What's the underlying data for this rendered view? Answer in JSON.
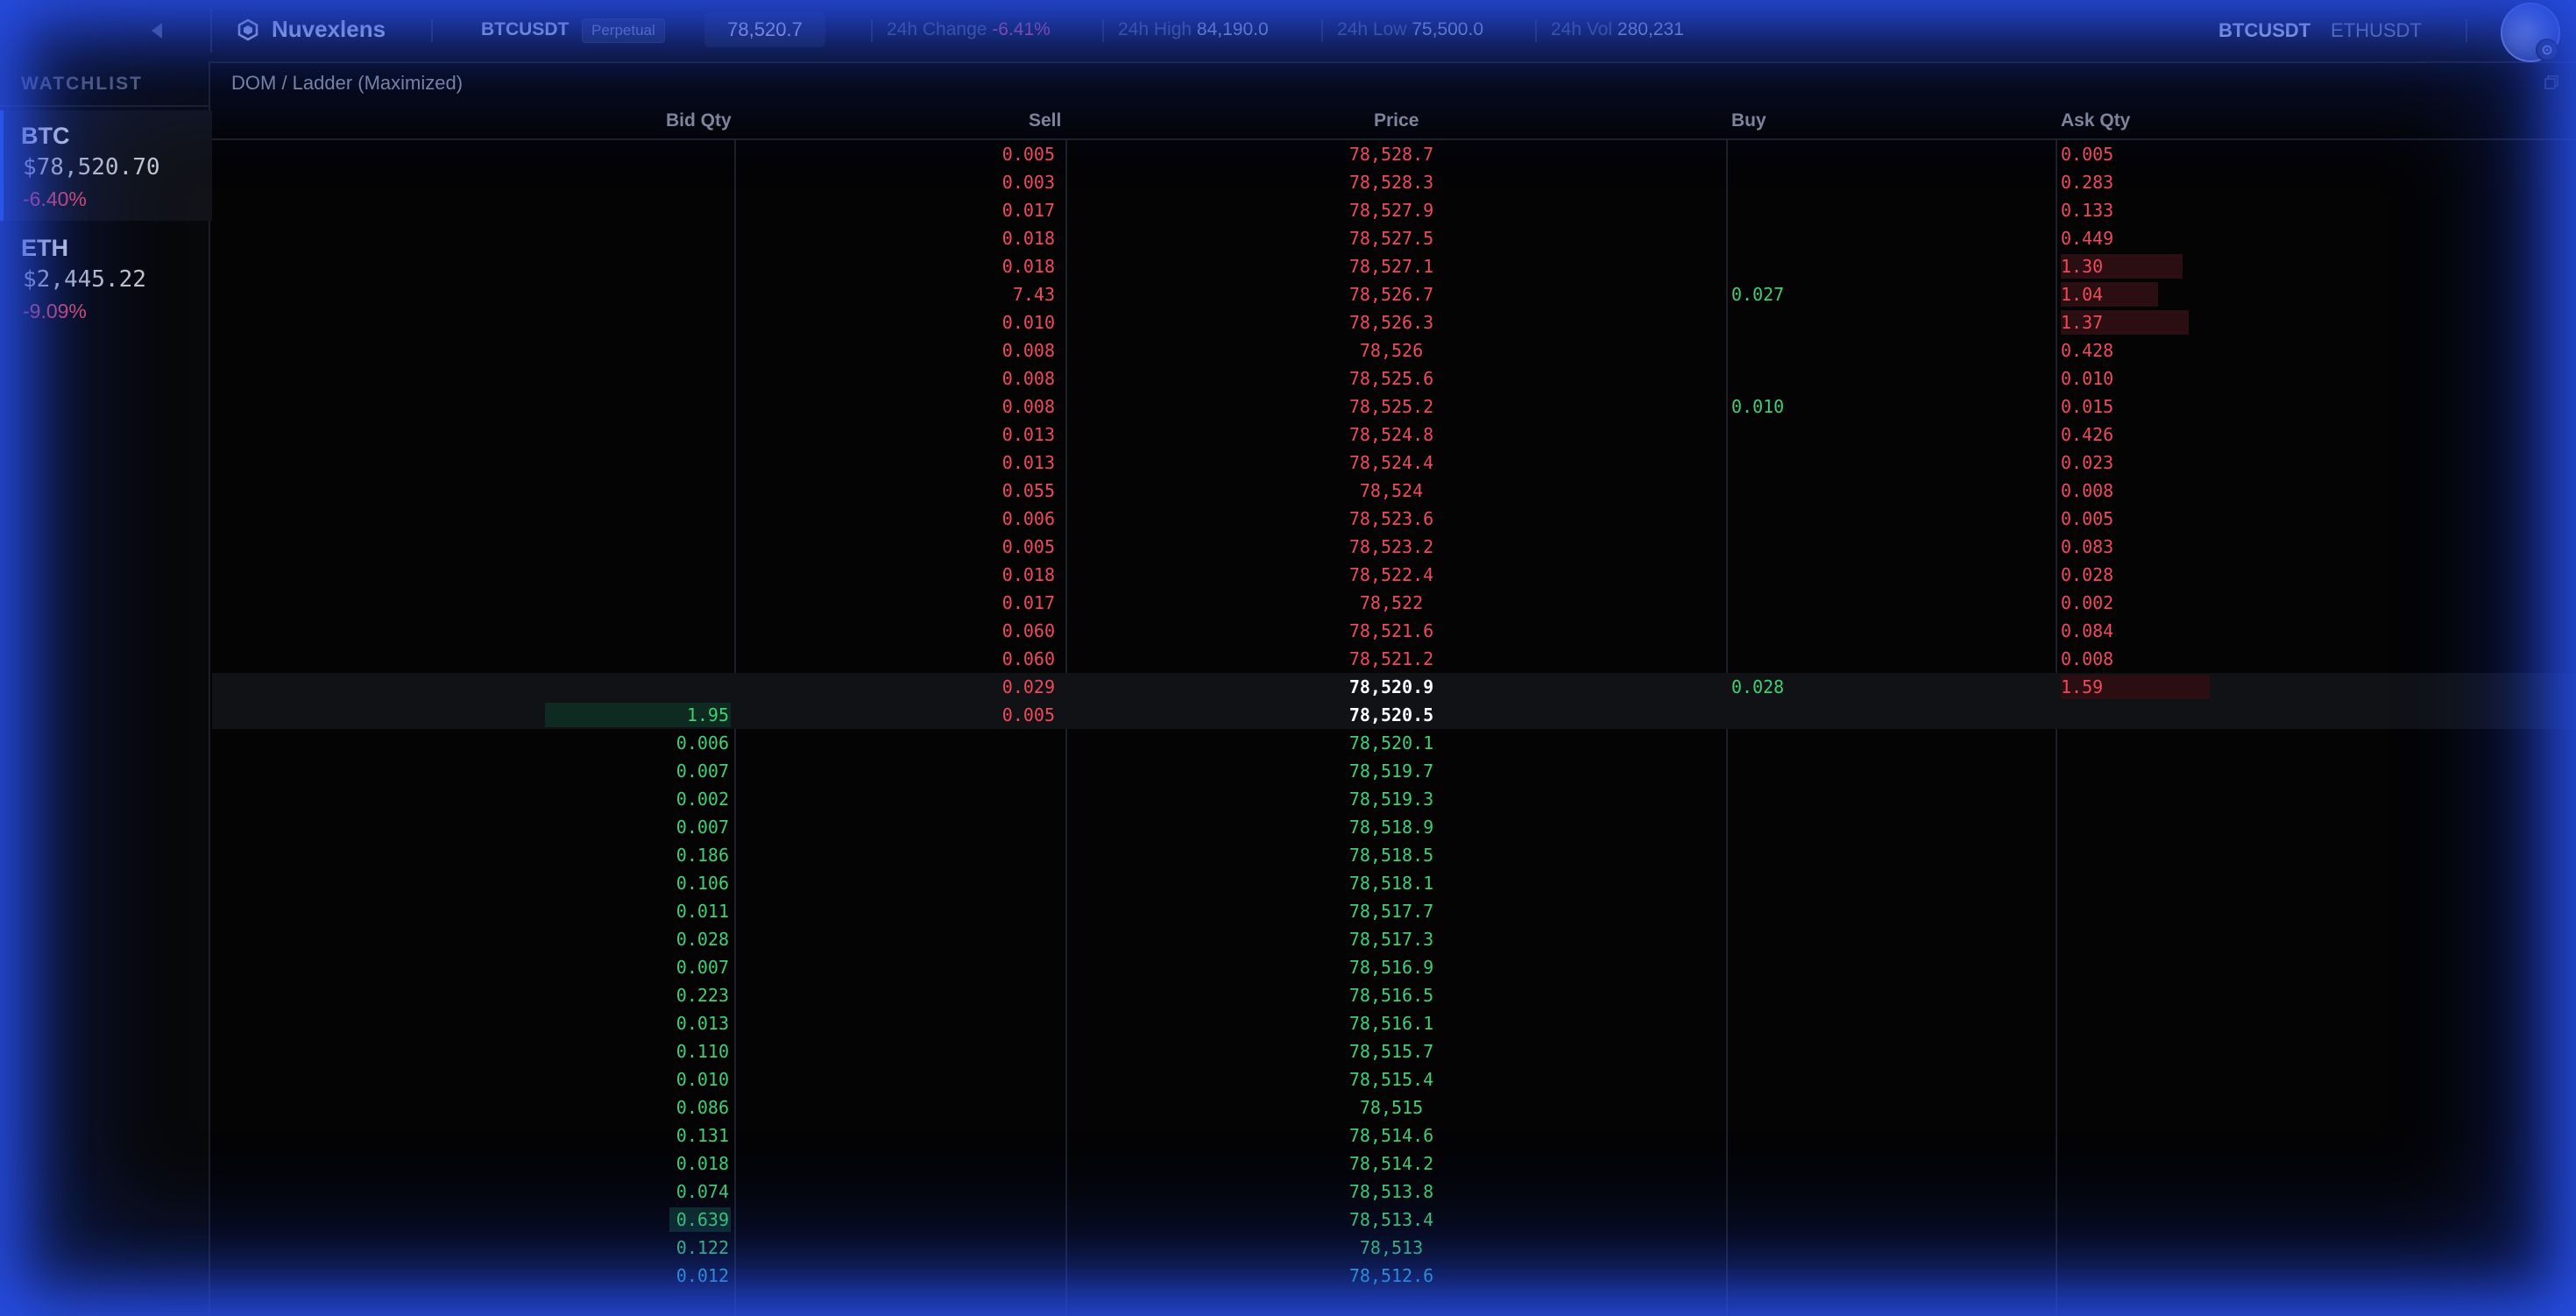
{
  "topbar": {
    "brand": "Nuvexlens",
    "symbol": "BTCUSDT",
    "badge": "Perpetual",
    "last_price": "78,520.7",
    "change_label": "24h Change",
    "change_value": "-6.41%",
    "high_label": "24h High",
    "high_value": "84,190.0",
    "low_label": "24h Low",
    "low_value": "75,500.0",
    "vol_label": "24h Vol",
    "vol_value": "280,231",
    "tabs": [
      "BTCUSDT",
      "ETHUSDT"
    ]
  },
  "sidebar": {
    "title": "WATCHLIST",
    "items": [
      {
        "symbol": "BTC",
        "price": "$78,520.70",
        "change": "-6.40%"
      },
      {
        "symbol": "ETH",
        "price": "$2,445.22",
        "change": "-9.09%"
      }
    ]
  },
  "panel": {
    "title": "DOM / Ladder (Maximized)",
    "headers": {
      "bid": "Bid Qty",
      "sell": "Sell",
      "price": "Price",
      "buy": "Buy",
      "ask": "Ask Qty"
    }
  },
  "colors": {
    "accent": "#3a7bff",
    "ask": "#f04a5a",
    "bid": "#3fd070",
    "glow": "#2850eb"
  },
  "ladder": [
    {
      "sell": "0.005",
      "price": "78,528.7",
      "buy": "",
      "ask": "0.005",
      "side": "ask"
    },
    {
      "sell": "0.003",
      "price": "78,528.3",
      "buy": "",
      "ask": "0.283",
      "side": "ask"
    },
    {
      "sell": "0.017",
      "price": "78,527.9",
      "buy": "",
      "ask": "0.133",
      "side": "ask"
    },
    {
      "sell": "0.018",
      "price": "78,527.5",
      "buy": "",
      "ask": "0.449",
      "side": "ask"
    },
    {
      "sell": "0.018",
      "price": "78,527.1",
      "buy": "",
      "ask": "1.30",
      "side": "ask",
      "ask_bar": 0.82
    },
    {
      "sell": "7.43",
      "price": "78,526.7",
      "buy": "0.027",
      "ask": "1.04",
      "side": "ask",
      "ask_bar": 0.65
    },
    {
      "sell": "0.010",
      "price": "78,526.3",
      "buy": "",
      "ask": "1.37",
      "side": "ask",
      "ask_bar": 0.86
    },
    {
      "sell": "0.008",
      "price": "78,526",
      "buy": "",
      "ask": "0.428",
      "side": "ask"
    },
    {
      "sell": "0.008",
      "price": "78,525.6",
      "buy": "",
      "ask": "0.010",
      "side": "ask"
    },
    {
      "sell": "0.008",
      "price": "78,525.2",
      "buy": "0.010",
      "ask": "0.015",
      "side": "ask"
    },
    {
      "sell": "0.013",
      "price": "78,524.8",
      "buy": "",
      "ask": "0.426",
      "side": "ask"
    },
    {
      "sell": "0.013",
      "price": "78,524.4",
      "buy": "",
      "ask": "0.023",
      "side": "ask"
    },
    {
      "sell": "0.055",
      "price": "78,524",
      "buy": "",
      "ask": "0.008",
      "side": "ask"
    },
    {
      "sell": "0.006",
      "price": "78,523.6",
      "buy": "",
      "ask": "0.005",
      "side": "ask"
    },
    {
      "sell": "0.005",
      "price": "78,523.2",
      "buy": "",
      "ask": "0.083",
      "side": "ask"
    },
    {
      "sell": "0.018",
      "price": "78,522.4",
      "buy": "",
      "ask": "0.028",
      "side": "ask"
    },
    {
      "sell": "0.017",
      "price": "78,522",
      "buy": "",
      "ask": "0.002",
      "side": "ask"
    },
    {
      "sell": "0.060",
      "price": "78,521.6",
      "buy": "",
      "ask": "0.084",
      "side": "ask"
    },
    {
      "sell": "0.060",
      "price": "78,521.2",
      "buy": "",
      "ask": "0.008",
      "side": "ask"
    },
    {
      "sell": "0.029",
      "price": "78,520.9",
      "buy": "0.028",
      "ask": "1.59",
      "side": "best",
      "ask_bar": 1.0
    },
    {
      "bid": "1.95",
      "sell": "0.005",
      "price": "78,520.5",
      "side": "best",
      "bid_bar": 1.0
    },
    {
      "bid": "0.006",
      "price": "78,520.1",
      "side": "bid"
    },
    {
      "bid": "0.007",
      "price": "78,519.7",
      "side": "bid"
    },
    {
      "bid": "0.002",
      "price": "78,519.3",
      "side": "bid"
    },
    {
      "bid": "0.007",
      "price": "78,518.9",
      "side": "bid"
    },
    {
      "bid": "0.186",
      "price": "78,518.5",
      "side": "bid"
    },
    {
      "bid": "0.106",
      "price": "78,518.1",
      "side": "bid"
    },
    {
      "bid": "0.011",
      "price": "78,517.7",
      "side": "bid"
    },
    {
      "bid": "0.028",
      "price": "78,517.3",
      "side": "bid"
    },
    {
      "bid": "0.007",
      "price": "78,516.9",
      "side": "bid"
    },
    {
      "bid": "0.223",
      "price": "78,516.5",
      "side": "bid"
    },
    {
      "bid": "0.013",
      "price": "78,516.1",
      "side": "bid"
    },
    {
      "bid": "0.110",
      "price": "78,515.7",
      "side": "bid"
    },
    {
      "bid": "0.010",
      "price": "78,515.4",
      "side": "bid"
    },
    {
      "bid": "0.086",
      "price": "78,515",
      "side": "bid"
    },
    {
      "bid": "0.131",
      "price": "78,514.6",
      "side": "bid"
    },
    {
      "bid": "0.018",
      "price": "78,514.2",
      "side": "bid"
    },
    {
      "bid": "0.074",
      "price": "78,513.8",
      "side": "bid"
    },
    {
      "bid": "0.639",
      "price": "78,513.4",
      "side": "bid",
      "bid_bar": 0.33
    },
    {
      "bid": "0.122",
      "price": "78,513",
      "side": "bid"
    },
    {
      "bid": "0.012",
      "price": "78,512.6",
      "side": "edge"
    }
  ]
}
